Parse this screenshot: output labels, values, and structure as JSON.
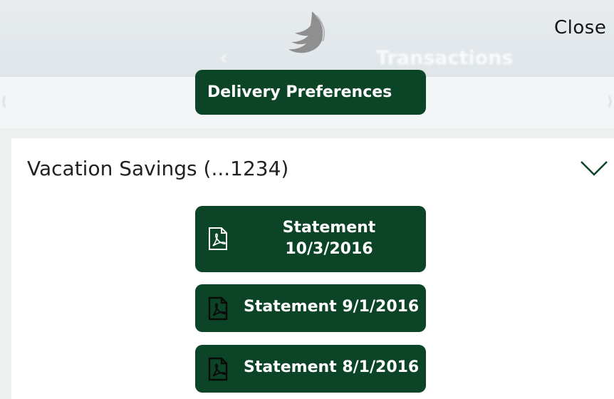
{
  "header": {
    "close_label": "Close",
    "back_glyph": "‹",
    "background_title": "Transactions"
  },
  "logo": {
    "icon": "eagle-wing-logo"
  },
  "delivery_preferences_label": "Delivery Preferences",
  "account": {
    "name": "Vacation Savings (...1234)",
    "expand_icon": "chevron-down-icon"
  },
  "statements": [
    {
      "line1": "Statement",
      "line2": "10/3/2016",
      "icon": "pdf-icon"
    },
    {
      "label": "Statement 9/1/2016",
      "icon": "pdf-icon"
    },
    {
      "label": "Statement 8/1/2016",
      "icon": "pdf-icon"
    }
  ],
  "colors": {
    "button_green": "#0c4428",
    "chevron_green": "#0c4428",
    "text_dark": "#222222"
  }
}
